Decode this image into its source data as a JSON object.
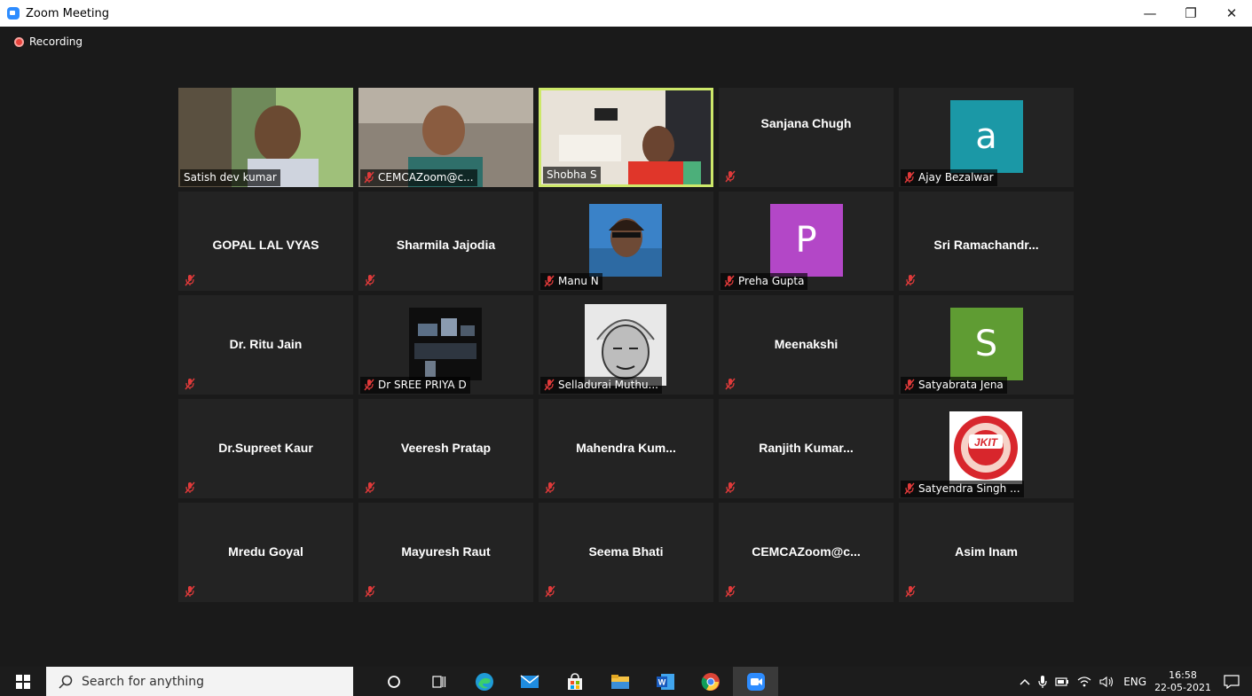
{
  "window": {
    "title": "Zoom Meeting",
    "minimize": "—",
    "restore": "❐",
    "close": "✕"
  },
  "recording": {
    "label": "Recording"
  },
  "participants": [
    {
      "name": "Satish dev kumar",
      "type": "video",
      "muted": false
    },
    {
      "name": "CEMCAZoom@c...",
      "type": "video",
      "muted": true
    },
    {
      "name": "Shobha S",
      "type": "video",
      "muted": false,
      "active": true
    },
    {
      "name": "Sanjana Chugh",
      "type": "name",
      "muted": true
    },
    {
      "name": "Ajay Bezalwar",
      "type": "avatar",
      "letter": "a",
      "color": "#1b98a6",
      "muted": true
    },
    {
      "name": "GOPAL LAL VYAS",
      "type": "name",
      "muted": true
    },
    {
      "name": "Sharmila Jajodia",
      "type": "name",
      "muted": true
    },
    {
      "name": "Manu N",
      "type": "photo",
      "muted": true
    },
    {
      "name": "Preha Gupta",
      "type": "avatar",
      "letter": "P",
      "color": "#b347c7",
      "muted": true
    },
    {
      "name": "Sri  Ramachandr...",
      "type": "name",
      "muted": true
    },
    {
      "name": "Dr. Ritu Jain",
      "type": "name",
      "muted": true
    },
    {
      "name": "Dr SREE PRIYA D",
      "type": "photo",
      "muted": true
    },
    {
      "name": "Selladurai Muthu...",
      "type": "photo",
      "muted": true
    },
    {
      "name": "Meenakshi",
      "type": "name",
      "muted": true
    },
    {
      "name": "Satyabrata Jena",
      "type": "avatar",
      "letter": "S",
      "color": "#5f9c33",
      "muted": true
    },
    {
      "name": "Dr.Supreet Kaur",
      "type": "name",
      "muted": true
    },
    {
      "name": "Veeresh Pratap",
      "type": "name",
      "muted": true
    },
    {
      "name": "Mahendra  Kum...",
      "type": "name",
      "muted": true
    },
    {
      "name": "Ranjith  Kumar...",
      "type": "name",
      "muted": true
    },
    {
      "name": "Satyendra Singh ...",
      "type": "photo",
      "logo_text": "JKIT",
      "muted": true
    },
    {
      "name": "Mredu Goyal",
      "type": "name",
      "muted": true
    },
    {
      "name": "Mayuresh Raut",
      "type": "name",
      "muted": true
    },
    {
      "name": "Seema Bhati",
      "type": "name",
      "muted": true
    },
    {
      "name": "CEMCAZoom@c...",
      "type": "name",
      "muted": true
    },
    {
      "name": "Asim Inam",
      "type": "name",
      "muted": true
    }
  ],
  "taskbar": {
    "search_placeholder": "Search for anything",
    "language": "ENG",
    "time": "16:58",
    "date": "22-05-2021"
  },
  "colors": {
    "active_speaker_border": "#cde86a",
    "muted_mic": "#e03a3a",
    "tile_bg": "#232323"
  }
}
